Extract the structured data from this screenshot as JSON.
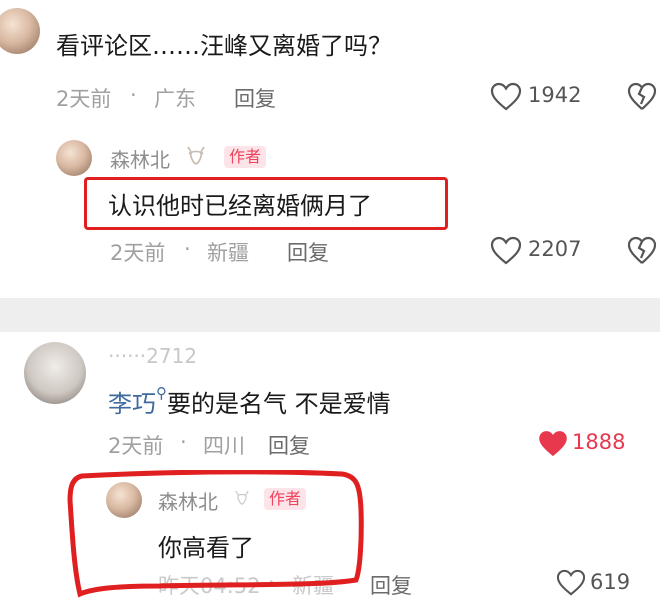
{
  "comments": [
    {
      "text": "看评论区……汪峰又离婚了吗？",
      "time": "2天前",
      "dot": "·",
      "location": "广东",
      "reply_label": "回复",
      "likes": "1942",
      "reply": {
        "username": "森林北",
        "badge": "作者",
        "text": "认识他时已经离婚俩月了",
        "time": "2天前",
        "dot": "·",
        "location": "新疆",
        "reply_label": "回复",
        "likes": "2207"
      }
    },
    {
      "username": "······2712",
      "mention": "李巧",
      "text": "要的是名气  不是爱情",
      "time": "2天前",
      "dot": "·",
      "location": "四川",
      "reply_label": "回复",
      "likes": "1888",
      "reply": {
        "username": "森林北",
        "badge": "作者",
        "text": "你高看了",
        "time": "昨天04:52",
        "dot": "·",
        "location": "新疆",
        "reply_label": "回复",
        "likes": "619"
      }
    }
  ],
  "colors": {
    "like_active": "#e8384e",
    "highlight_box": "#e02020",
    "author_badge": "#f0425c"
  }
}
